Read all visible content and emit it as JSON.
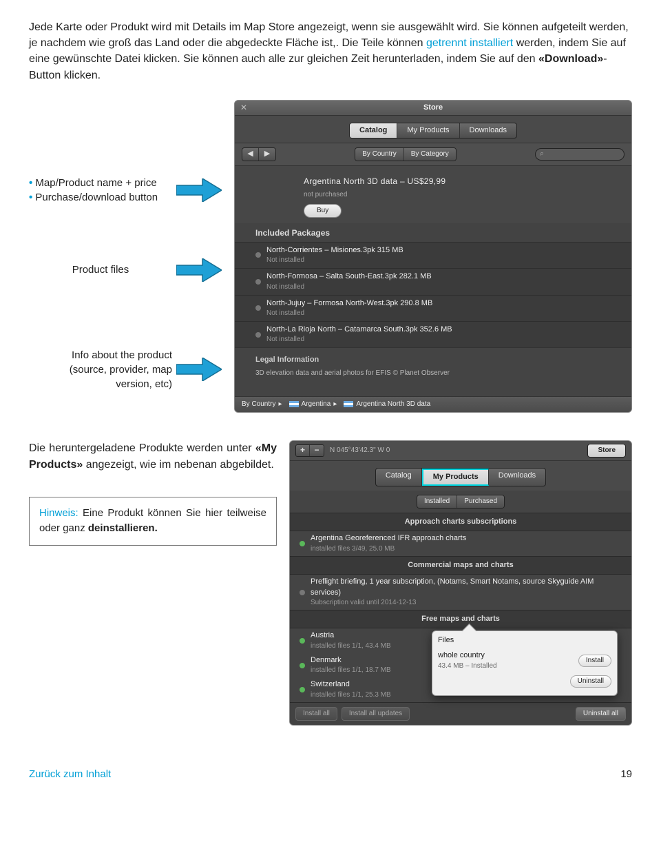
{
  "intro": {
    "s1": "Jede Karte oder Produkt wird mit Details im Map Store angezeigt, wenn sie ausgewählt wird. Sie können aufgeteilt werden, je nachdem wie groß das Land oder die abgedeckte Fläche ist,. Die Teile können ",
    "highlight": "getrennt installiert",
    "s2": " werden, indem Sie auf eine gewünschte Datei klicken. Sie können auch alle zur gleichen Zeit herunterladen, indem Sie auf den ",
    "bold": "«Download»",
    "s3": "-Button klicken."
  },
  "annot": {
    "b1": "Map/Product name + price",
    "b2": "Purchase/download button",
    "files": "Product files",
    "info_l1": "Info about the product",
    "info_l2": "(source, provider, map",
    "info_l3": "version, etc)"
  },
  "store1": {
    "title": "Store",
    "tabs": {
      "catalog": "Catalog",
      "myprod": "My Products",
      "downloads": "Downloads"
    },
    "nav_back": "◀",
    "nav_fwd": "▶",
    "filter_country": "By Country",
    "filter_category": "By Category",
    "search_icon": "⌕",
    "product_title": "Argentina North 3D data – US$29,99",
    "product_status": "not purchased",
    "buy": "Buy",
    "included_h": "Included Packages",
    "packages": [
      {
        "t": "North-Corrientes – Misiones.3pk 315 MB",
        "s": "Not installed"
      },
      {
        "t": "North-Formosa – Salta South-East.3pk 282.1 MB",
        "s": "Not installed"
      },
      {
        "t": "North-Jujuy – Formosa North-West.3pk 290.8 MB",
        "s": "Not installed"
      },
      {
        "t": "North-La Rioja North – Catamarca South.3pk 352.6 MB",
        "s": "Not installed"
      }
    ],
    "legal_h": "Legal Information",
    "legal_t": "3D elevation data and aerial photos for EFIS © Planet Observer",
    "bc_country": "By Country",
    "bc_arg": "Argentina",
    "bc_data": "Argentina North 3D data"
  },
  "para2": {
    "t1": "Die heruntergeladene Produkte werden unter ",
    "bold": "«My Products»",
    "t2": " angezeigt, wie im nebenan abgebildet."
  },
  "hinweis": {
    "label": "Hinweis:",
    "text": " Eine Produkt können Sie hier teilweise oder ganz ",
    "bold": "deinstallieren."
  },
  "store2": {
    "coord": "N 045°43'42.3\"  W 0",
    "store_btn": "Store",
    "tabs": {
      "catalog": "Catalog",
      "myprod": "My Products",
      "downloads": "Downloads"
    },
    "sub_installed": "Installed",
    "sub_purchased": "Purchased",
    "cat1": "Approach charts subscriptions",
    "row1_t": "Argentina Georeferenced IFR approach charts",
    "row1_s": "installed files 3/49, 25.0 MB",
    "cat2": "Commercial maps and charts",
    "row2_t": "Preflight briefing, 1 year subscription,  (Notams, Smart Notams, source Skyguide AIM services)",
    "row2_s": "Subscription valid until 2014-12-13",
    "cat3": "Free maps and charts",
    "free": [
      {
        "t": "Austria",
        "s": "installed files 1/1, 43.4 MB"
      },
      {
        "t": "Denmark",
        "s": "installed files 1/1, 18.7 MB"
      },
      {
        "t": "Switzerland",
        "s": "installed files 1/1, 25.3 MB"
      }
    ],
    "popover": {
      "h": "Files",
      "item_t": "whole country",
      "item_s": "43.4 MB – Installed",
      "install": "Install",
      "uninstall": "Uninstall"
    },
    "bottom_install_all": "Install all",
    "bottom_install_upd": "Install all updates",
    "bottom_uninstall_all": "Uninstall all"
  },
  "footer": {
    "back": "Zurück zum Inhalt",
    "page": "19"
  }
}
